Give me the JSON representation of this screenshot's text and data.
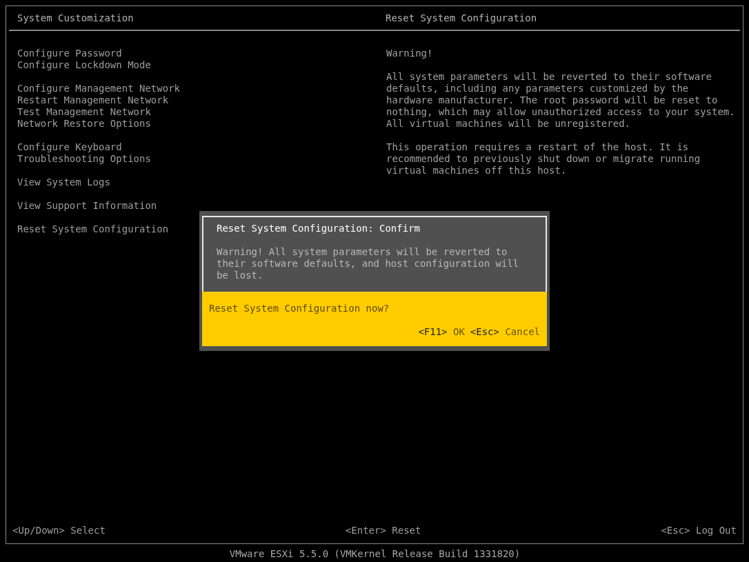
{
  "left_panel": {
    "title": "System Customization",
    "groups": [
      {
        "items": [
          "Configure Password",
          "Configure Lockdown Mode"
        ]
      },
      {
        "items": [
          "Configure Management Network",
          "Restart Management Network",
          "Test Management Network",
          "Network Restore Options"
        ]
      },
      {
        "items": [
          "Configure Keyboard",
          "Troubleshooting Options"
        ]
      },
      {
        "items": [
          "View System Logs"
        ]
      },
      {
        "items": [
          "View Support Information"
        ]
      },
      {
        "items": [
          "Reset System Configuration"
        ]
      }
    ]
  },
  "right_panel": {
    "title": "Reset System Configuration",
    "paragraphs": [
      "Warning!",
      "All system parameters will be reverted to their software\ndefaults, including any parameters customized by the\nhardware manufacturer. The root password will be reset to\nnothing, which may allow unauthorized access to your system.\nAll virtual machines will be unregistered.",
      "This operation requires a restart of the host. It is\nrecommended to previously shut down or migrate running\nvirtual machines off this host."
    ]
  },
  "dialog": {
    "title": "Reset System Configuration: Confirm",
    "message": "Warning! All system parameters will be reverted to\ntheir software defaults, and host configuration will\nbe lost.",
    "question": "Reset System Configuration now?",
    "actions": [
      {
        "key": "<F11>",
        "label": "OK"
      },
      {
        "key": "<Esc>",
        "label": "Cancel"
      }
    ]
  },
  "footer_hints": [
    "<Up/Down> Select",
    "<Enter> Reset",
    "<Esc> Log Out"
  ],
  "version": "VMware ESXi 5.5.0 (VMKernel Release Build 1331820)"
}
